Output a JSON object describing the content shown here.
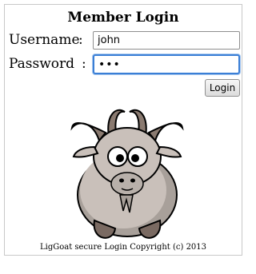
{
  "login": {
    "title": "Member Login",
    "username_label": "Username",
    "username_colon": ":",
    "username_value": "john",
    "password_label": "Password",
    "password_colon": ":",
    "password_value": "•••",
    "login_button": "Login"
  },
  "footer": {
    "text": "LigGoat secure Login Copyright (c) 2013"
  },
  "colors": {
    "focus_border": "#3b7fd6",
    "goat_fur": "#c9c0ba",
    "goat_horn": "#8a7a70",
    "goat_hoof": "#7a6a62"
  },
  "icons": {
    "mascot": "goat-mascot-icon"
  }
}
